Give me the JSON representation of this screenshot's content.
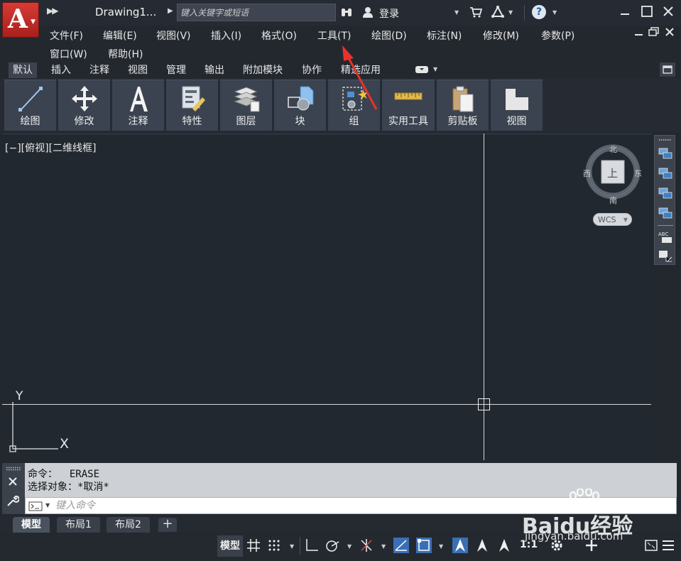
{
  "titlebar": {
    "app_icon_letter": "A",
    "doc_title": "Drawing1...",
    "search_placeholder": "键入关键字或短语",
    "login_label": "登录"
  },
  "menubar": {
    "items": [
      "文件(F)",
      "编辑(E)",
      "视图(V)",
      "插入(I)",
      "格式(O)",
      "工具(T)",
      "绘图(D)",
      "标注(N)",
      "修改(M)",
      "参数(P)",
      "窗口(W)",
      "帮助(H)"
    ]
  },
  "ribbon": {
    "tabs": [
      "默认",
      "插入",
      "注释",
      "视图",
      "管理",
      "输出",
      "附加模块",
      "协作",
      "精选应用"
    ],
    "active_tab": "默认",
    "panels": [
      "绘图",
      "修改",
      "注释",
      "特性",
      "图层",
      "块",
      "组",
      "实用工具",
      "剪贴板",
      "视图"
    ]
  },
  "viewport": {
    "label": "[−][俯视][二维线框]",
    "ucs_x": "X",
    "ucs_y": "Y"
  },
  "viewcube": {
    "north": "北",
    "south": "南",
    "east": "东",
    "west": "西",
    "face": "上",
    "wcs_label": "WCS"
  },
  "command": {
    "history": [
      "命令：  ERASE",
      "选择对象：*取消*"
    ],
    "input_placeholder": "键入命令"
  },
  "layout_tabs": [
    "模型",
    "布局1",
    "布局2"
  ],
  "status": {
    "model_label": "模型",
    "scale_label": "1:1"
  },
  "watermark": {
    "text": "Baidu经验",
    "url": "jingyan.baidu.com"
  },
  "colors": {
    "background": "#212830",
    "ribbon_panel": "#3b4350",
    "app_logo": "#c8302b",
    "annotation_arrow": "#e8322b",
    "status_active": "#3a6fb5"
  }
}
